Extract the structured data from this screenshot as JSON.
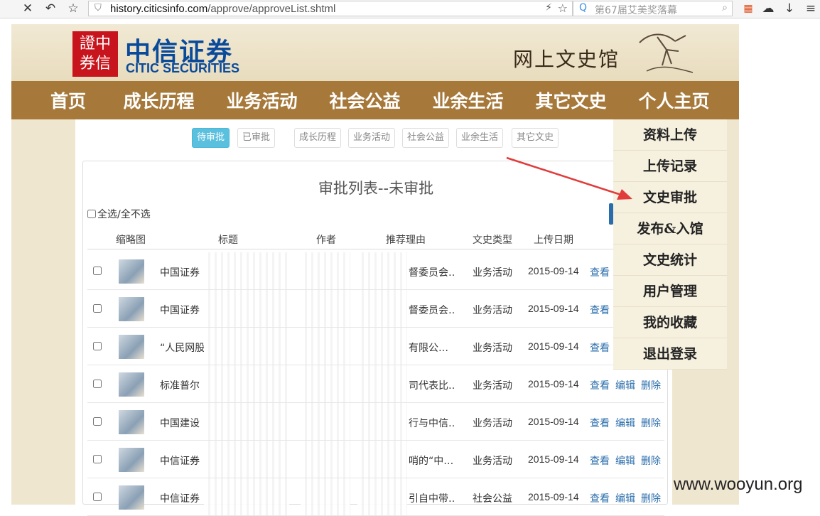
{
  "browser": {
    "url_host": "history.citicsinfo.com",
    "url_path": "/approve/approveList.shtml",
    "search_placeholder": "第67届艾美奖落幕"
  },
  "brand": {
    "seal": "證中券信",
    "name_cn": "中信证券",
    "name_en": "CITIC SECURITIES",
    "site_title": "网上文史馆"
  },
  "nav": [
    "首页",
    "成长历程",
    "业务活动",
    "社会公益",
    "业余生活",
    "其它文史",
    "个人主页"
  ],
  "tabs": {
    "status": [
      "待审批",
      "已审批"
    ],
    "categories": [
      "成长历程",
      "业务活动",
      "社会公益",
      "业余生活",
      "其它文史"
    ]
  },
  "panel": {
    "title": "审批列表--未审批",
    "select_all": "全选/全不选",
    "headers": [
      "缩略图",
      "标题",
      "作者",
      "推荐理由",
      "文史类型",
      "上传日期"
    ]
  },
  "rows": [
    {
      "title": "中国证券",
      "reason": "督委员会…",
      "type": "业务活动",
      "date": "2015-09-14",
      "actions": [
        "查看"
      ]
    },
    {
      "title": "中国证券",
      "reason": "督委员会…",
      "type": "业务活动",
      "date": "2015-09-14",
      "actions": [
        "查看"
      ]
    },
    {
      "title": "“人民网股",
      "reason": "有限公…",
      "type": "业务活动",
      "date": "2015-09-14",
      "actions": [
        "查看"
      ]
    },
    {
      "title": "标准普尔",
      "reason": "司代表比…",
      "type": "业务活动",
      "date": "2015-09-14",
      "actions": [
        "查看",
        "编辑",
        "删除"
      ]
    },
    {
      "title": "中国建设",
      "reason": "行与中信…",
      "type": "业务活动",
      "date": "2015-09-14",
      "actions": [
        "查看",
        "编辑",
        "删除"
      ]
    },
    {
      "title": "中信证券",
      "reason": "哨的“中…",
      "type": "业务活动",
      "date": "2015-09-14",
      "actions": [
        "查看",
        "编辑",
        "删除"
      ]
    },
    {
      "title": "中信证券",
      "reason": "引自中带…",
      "type": "社会公益",
      "date": "2015-09-14",
      "actions": [
        "查看",
        "编辑",
        "删除"
      ]
    }
  ],
  "sidebar": [
    "资料上传",
    "上传记录",
    "文史审批",
    "发布&入馆",
    "文史统计",
    "用户管理",
    "我的收藏",
    "退出登录"
  ],
  "watermark": "www.wooyun.org",
  "colors": {
    "nav_bg": "#a6783a",
    "accent": "#5bc0de",
    "link": "#2a6dab",
    "arrow": "#e23b3b",
    "brand": "#0a4a9a",
    "seal": "#c8141c"
  }
}
